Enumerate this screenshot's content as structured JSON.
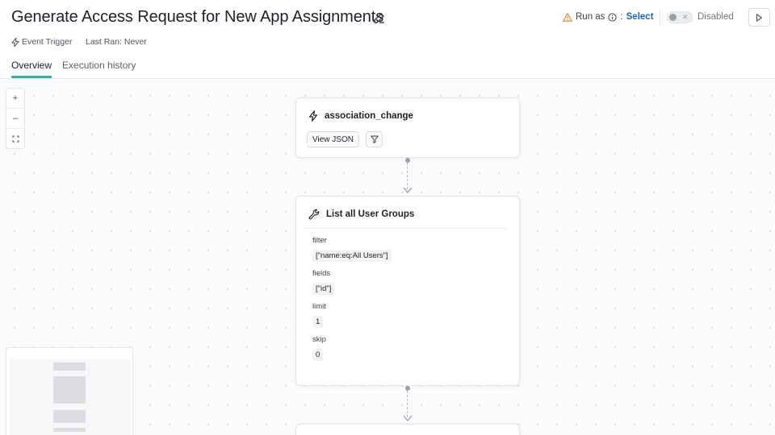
{
  "header": {
    "title": "Generate Access Request for New App Assignments",
    "event_trigger": "Event Trigger",
    "last_ran": "Last Ran: Never",
    "run_as_label": "Run as",
    "run_as_sep": ":",
    "select_label": "Select",
    "status_label": "Disabled",
    "toggle_x": "✕"
  },
  "tabs": [
    {
      "label": "Overview",
      "active": true
    },
    {
      "label": "Execution history",
      "active": false
    }
  ],
  "zoom": {
    "in": "+",
    "out": "–",
    "fit": "⛶"
  },
  "nodes": {
    "trigger": {
      "title": "association_change",
      "view_json": "View JSON",
      "icon": "lightning-icon",
      "filter_icon": "filter-icon"
    },
    "action": {
      "title": "List all User Groups",
      "icon": "wrench-icon",
      "params": [
        {
          "label": "filter",
          "value": "[\"name:eq:All Users\"]"
        },
        {
          "label": "fields",
          "value": "[\"id\"]"
        },
        {
          "label": "limit",
          "value": "1"
        },
        {
          "label": "skip",
          "value": "0"
        }
      ]
    }
  },
  "colors": {
    "accent_tab": "#2fb4b0",
    "link": "#1664c9",
    "warning": "#e0892a"
  }
}
